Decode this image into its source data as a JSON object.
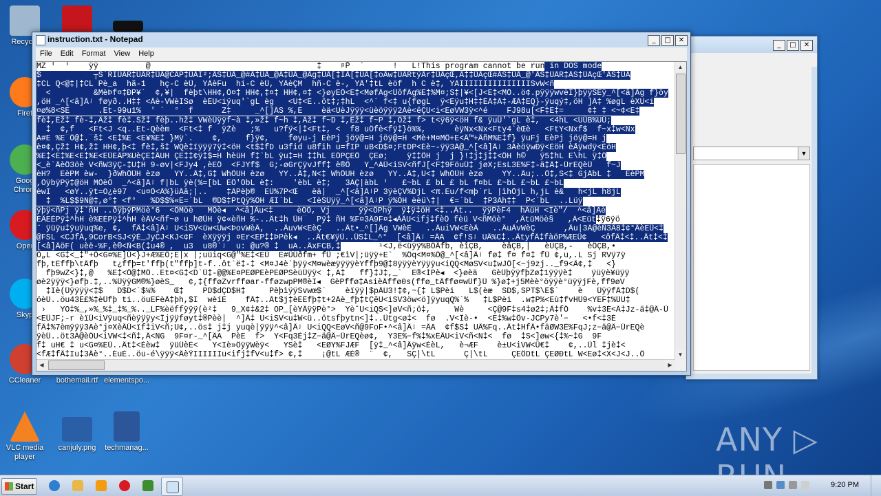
{
  "desktop": {
    "icons": [
      {
        "label": "Recycle",
        "color": "#9fb7cf"
      },
      {
        "label": "",
        "color": "#c4161c"
      },
      {
        "label": "",
        "color": "#111111"
      },
      {
        "label": "Firef",
        "color": "#ff7a1a"
      },
      {
        "label": "Goog\nChrom",
        "color": "#4caf50"
      },
      {
        "label": "Oper",
        "color": "#d81b21"
      },
      {
        "label": "Skyp",
        "color": "#00aff0"
      },
      {
        "label": "CCleaner",
        "color": "#d04030"
      },
      {
        "label": "bothemail.rtf",
        "color": "#ffffff"
      },
      {
        "label": "elementspo...",
        "color": "#eaeaea"
      },
      {
        "label": "VLC media player",
        "color": "#f58220"
      },
      {
        "label": "canjuly.png",
        "color": "#2a5fa8"
      },
      {
        "label": "techmanag...",
        "color": "#2b579a"
      }
    ]
  },
  "back_window": {
    "controls": [
      "_",
      "□",
      "✕"
    ]
  },
  "notepad": {
    "title": "instruction.txt - Notepad",
    "menu": [
      "File",
      "Edit",
      "Format",
      "View",
      "Help"
    ],
    "controls": [
      "_",
      "□",
      "✕"
    ],
    "lines": [
      {
        "text": "MZ ╵  ╵    ÿÿ          @                                   ‡    ᵖP̄  ´      !   L!This program cannot be run in DOS mode",
        "sel_from": 108
      },
      {
        "text": "$           ┬S`RIÜÄR‡ÜÄR‡ÜÄ@CÄP‡ÜÄI²;ÄS‡ÜÄ_@#Ä‡ÜÄ_@Ä‡ÜÄ_@Äg‡ÜÄ[‡IÄ[‡ÜÄ[‡oÄw‡ÜÄRtÿÄr‡ÜÄçŒ‚Ä‡‡ÜÄçŒ#ÄS‡ÜÄ_@'ÄS‡ÜÄR‡ÄS‡ÜÄçŒ'ÄS‡ÜÄ",
        "sel_from": 0
      },
      {
        "text": "‡CL Q<@‡|‡CL Pè_a  hã-1   hç-C èÜ, YÄèFu  hi-C èÜ, YÄèÇM  hñ-C è-, YÄ'‡tL èöf  h C è‡, YÄIIIIIIIIIIIIIIISvW<ñ",
        "sel_from": 0
      },
      {
        "text": "  <         &MèÞf¤‡ÐP¥´  ¢,¥|  fèþt\\HH¢,Ö¤‡ HH¢,‡¤‡ HH¢,¤‡ <}øyEÖ<E‡<MøfÂg<ÜôfÂg%E‡%M¤;S‡|¥<[J<E‡<MÖ..ö¢.pÿÿÿwvèI}þÿÿSEÿ_^[<â]Âg f}öy",
        "sel_from": 0
      },
      {
        "text": ",öH _^[<â]Âʲ føyð..H‡‡ <Äè-VWèISø  èÉU<iÿuq'`gL èg   <U‡<È..ôt‡;‡hL  <^´ f<‡ u{føgL  ÿ<Eÿu‡H‡‡ÉÄ‡Ä‡-ÆÄ‡EQ}-ÿuqý‡,öH ]Â‡ %øgL èXU<i",
        "sel_from": 0
      },
      {
        "text": "¤ø%8<SÈ      .Et-99u1%  ' ´  °  f      Z‡     _^[]ÄS %,È    èä<UèJÿÿÿ<üèöÿÿÿ2Àè<êÇU<i<EøVW3ÿ<^é    FJ98u[<F‡E‡=     ¢‡ ‡ <~¢<E‡",
        "sel_from": 0
      },
      {
        "text": "fè‡,Ëž‡ fè-‡,Äž‡ fè‡.Šž‡ fèþ..hž‡ VWèÜÿÿf~à ‡,»ž‡ f~h ‡,Äž‡ f~D ‡,Ëž‡ f~P ‡,Öž‡ f> t<ÿ6ÿ<öH f& ÿuÜ'`gL è‡,  <4hL <UÜB%UÜ;",
        "sel_from": 0
      },
      {
        "text": "  ‡  ¢,f   <Ft<J <q..Et-Qèèm  <Ft<‡ f  ÿŽè   ;%   u?fÿ<|‡<Ft‡, <  f8 uÖfè<fÿ‡}ö%%,      èÿNx<Nx<Fty4`èŒè   <FtY<Nxf$  f~x‡w<Nx",
        "sel_from": 0
      },
      {
        "text": "A#E %E¯Ö@‡.¯š‡ <E‡%E <E¥%E‡ }Mÿ`.    ¢,     f}ÿ¢,    føyu-j EèPj jöÿ@=H jöÿ@=H <Mè+M¤MÖ+E<Ä™+ÃñM%E‡f} ÿuFj EèPj jöÿ@=H j",
        "sel_from": 0
      },
      {
        "text": "è¤¢,Çž‡ H¢,ž‡ HH¢,þ<‡ fè‡,š‡ WQè‡ïÿÿÿ7ÿ‡<öH <t$‡fD u3fid u8fih u=fIP uB<D$¤;FtDP<Èè~-ÿÿ3À@_^[<â]Âʲ 3ÀèöÿwÐÿ<ÈöH èÅÿwdÿ<ÈöH",
        "sel_from": 0
      },
      {
        "text": "%E‡<E‡%E<E‡%E<EÜEÄP%UèÇE‡ÄUH ÇE‡‡¢ÿ‡$=H hèüH f‡`bL ÿu‡=H ‡‡hL EÖPÇEÖ  ÇEø;    ÿ‡‡ÖH j  j }!‡j‡j‡‡<ÖH h©   ÿ5‡hL E\\hL ÿ‡Ö",
        "sel_from": 0
      },
      {
        "text": "<_è`ÄèÖ3öè V<ñW3ÿÇ-‡U‡H 9-øv|<FJy4 ,èEÖ  <FJYf$  G;-øGrÇÿvJff‡ è®Ö   Y_^ÀÜ<iSV<ñfJ[<F‡9FöuÜ‡ jøX;EsL3E%F‡-ä‡Ä‡-ÜrEQèÜ   f~J",
        "sel_from": 0
      },
      {
        "text": "èH?  EèPM èw-  }ðWhÖÜH èzø   YY..Ä‡,G‡ WhÖUH èzø   YY..Ä‡,N<‡ WhÖUH èzø   YY..Ä‡,U<‡ WhÖÜH èzø    YY..Äu;..Ö‡,S<‡ GjÁbL ‡   EèPM",
        "sel_from": 0
      },
      {
        "text": ",ÖÿbÿPÿ‡@öH MÖèÖ  _^<â]Âʲ f|bL ÿè(%=[bL ÈÖ'ÖbL è‡:    'èbL è‡;   3ÀÇ|àbL ╵   £~bL £ bL £ bL f¤bL £~bL £~bL £~bL",
        "sel_from": 0
      },
      {
        "text": "èwI   <øY..ÿt=O¿è97  <u¤Ö<Â%}üÄâ;|..    ‡ÂPèþ®  EÜ%7P<Œ   èä|  _^[<â]ÂʲP 3ÿèÇV%DjL <π.Éu/f<mþ`rL |ìhÖjL h,jL è&   h<jL h8jL",
        "sel_from": 0
      },
      {
        "text": "  ‡  %L$$9N@‡,ø°‡ <f°   %D$$%«E=`bL  ®D$‡PtQÿ%ÖH ÆI`bL   <ÌèSÜÿÿ_^[<â]ÂʲP ÿ%ÖH èèü\\‡|  €=`bL  ‡P3Äh‡‡  P<`bL  ..Lüÿ",
        "sel_from": 0
      },
      {
        "text": "ÿþÿ<ñPj ÿ‡`ñH ..ðÿþÿPMöè°6  <ÖMöè   MÖè◂  ^<â]Äu<‡     èÓÖ, Vj      ÿÿ<ÖPhÿ  ÿ‡ÿ‡öH <‡..Ät..  ÿÿPèF4  hÄüH <Iè\"/  ^<â]Äè",
        "sel_from": 0
      },
      {
        "text": "ÈÄEÈPÿ‡^hH è%EÈPÿ‡^hH èÄV<ñf~ø u hØÜH ÿ¢«èñH %-..Ät‡h ÜH¯  Pÿ‡ ñH %F¤3Ä9F¤‡◂ÄÄU<ifj‡fèÖ fèü V<ñMöè°  ,ÄtüMöè§   ,À<Eüt‡ÿ6ÿö",
        "sel_from": 0,
        "sel_to": 118
      },
      {
        "text": "¨ ÿüÿu‡ÿuÿuq%e, ¢,  fÄ‡<â]Âʲ U<iSV<üw<Uw<ÞovWèÄ,  ..ÄuvW<EèÇ   ..Ät•_^[]Âg VWèÈ   ..ÄuiVW<ÈèÄ   ..ÄuÄvWèÇ      ,Äu|3Ä@èÑ3Ä8‡¢°ÄèEÜ<‡",
        "sel_from": 0
      },
      {
        "text": "@FSL <CJfÀ,9CorB<SJ<ÿÈ_JyCJ<KJ<¢F  èXÿÿÿj ¤Er<EP‡‡ÞPèk◂  ..Ät€¥ÿÜ..ÜS‡L_^°  [<â]Âʲ =ÄA  ¢f!Sʲ UÄ%C‡..ÄtyfÄ‡fàöP%ÆEÜ¢   <ôfÄ‡<‡..Ät‡<‡",
        "sel_from": 0
      },
      {
        "text": "[<â]ÄöF( uèë-%F,è®<Ñ<B(‡u4® ,  u3  u8®`ʲ  u: @u?® ‡  uA..ÄxFCB,‡        ¹<J,ë<üÿÿ%BÖÄfb, èîÇB,    èâÇB,|   èÛÇB,-   èÖÇB,•",
        "sel_from": 0,
        "sel_to": 64
      },
      {
        "text": "Ö„L <G‡<_‡\"+Ö<G¤%E]Ü<}J+Æ%EÖ;E|x |;uüiq<G@\"%E‡<EÜ  E#ÜÜðfm+ fÜ ;€ìV|;üÿÿ+E`  %Öq<M¤%Ö@_^[<â]Âʲ fø‡ f¤ f¤‡ fÜ ¢,u,.L Sj RVÿ7ÿ",
        "sel_from": -1
      },
      {
        "text": "fþ,tÈffþ\\tÄfþ   t¿ffþ=t'ffþ(t\"ffþ]t-f..ôt`ë‡-‡ <M¤J4è`þÿÿ<M¤wèæÿÿÿÿèYffþ9@‡8ÿÿÿèYÿÿÿu<iQQ<MøSV<u‡wJÖ[<~j9zj.._f9<Ä¢,‡   <}",
        "sel_from": -1
      },
      {
        "text": "  fþ9wZ<}‡,@   %E‡<Ö@‡MÖ..Et¤<G‡<D`Ü‡-@@%E¤PEØPEèPEØPSèüÜÿÿ< ‡,A‡   ff}‡J‡,_`  E®<ÍPè◂  <}øèä   GèÜþÿÿfþZø‡1ÿÿÿè‡    ÿüÿè¥üÿÿ",
        "sel_from": -1
      },
      {
        "text": "øè2ÿÿÿ<}øfþ.‡,..%ÜÿÿGM®%}øèS_   ¢,‡{fføZvrfføar-fføzwpPM®èI◂  GèPffø‡AsièÄffø0s(ffø_tÄffø¤wÜf}Ü %}ø‡+j5Mèè°öÿÿè°üÿÿjFè,ff9øV",
        "sel_from": -1
      },
      {
        "text": "  ‡Iè(Üÿÿÿÿ<‡$   D$D<`$¼%    Œ‡    PD$dÇD$H‡     PèþìÿÿSvwœ$`    èïÿÿ|$pÄU3!‡¢,~{‡ L$Pèi   L$(èæ  SD$,SPT$\\È$`    è   ÜÿÿfÄ‡D$(",
        "sel_from": -1
      },
      {
        "text": "öèÜ..öu43Ë£%‡èÜfþ ti..öuEFèÄ‡þh,$I  wèíÈ    fÄ‡..Ät$j‡èÈÈfþ‡t+2Äè_fþ‡tÇêU<iSV3öw<ö]ÿyuqQ%`%   ‡L$Pèi  .w‡P%<Eù‡fvHÜ9<YEF‡%ÜU‡",
        "sel_from": -1
      },
      {
        "text": " ›   YO‡%_,»%_%‡_‡%_%.._LF%èëffÿÿÿ(è²‡   9_X¢‡&2‡ OP_[èYÄÿÿPè°>  YèˆU<iQS<]øV<ñ;ö‡,     Wè     <Ç@9F‡s4‡ø2‡;Ä‡fÖ    %v‡3É<Ä‡Jz-ä‡@Ä-Ü",
        "sel_from": -1
      },
      {
        "text": "<EÜJF;-r¯èïÜ<iVÿuq<ñèÿÿÿy<Ïjÿÿføyt‡®Pèè|  ^]Ä‡ U<iSV<u‡W<ü..ötsfþytn<]‡..Ütg<ø‡<  fø  .V<Ïè-•  <E‡%w‡Öv-JCPy7è'−   <•f<‡3È",
        "sel_from": -1
      },
      {
        "text": "fÂ‡%7èmÿÿÿ3Aè°j¤XèÄÜ<ïf‡iV<ñ;U¢,..ös‡ j‡j yuqè|ÿÿÿ^<â]Âʲ U<iQQ<EøV<ñ@9FoF•^<â]Âʲ =ÄA  ¢f$S‡ UÄ%Fq..Ät‡HfÄ•fäØW3É%FqJ;z−ä@Ä−ÜrEQè",
        "sel_from": -1
      },
      {
        "text": "ÿèÜ..öt3À@èÖU<iVW<‡<ñ‡,Ä<NG  9F¤r-_^[ÂA  PèE  f>  Y<Fq3Èj‡Z−ä@Ä−ÜrEQèø¢,  Y3E%−f%‡%xÉÄU<iV<ñ<N‡<  fø  ‡S<]øw<{‡%~‡G  9F",
        "sel_from": -1
      },
      {
        "text": "f‡ uH€ ‡ u<G¤%EÜ..Ät‡<Èèw‡  ÿüÜèÈ<   Y<Iè»ÖÿÿWèÿ<   YSè‡   <EØY%FJÆF  [ÿ‡_^<â]Äÿw<ÈèL,   è¬ÆF    è±U<iVW<Ü€‡    ¢,..Ül ‡jè‡<",
        "sel_from": -1
      },
      {
        "text": "<fÆ‡fÄ‡Iu‡3Äè°..ÉuÈ..öu-é\\ÿÿÿ<ÄèŸIIIIIIu<ifj‡fV<u‡f> ¢,‡    ¡@tL ÆÈ®  ¨  ¢,   SÇ|\\tL      Ç|\\tL     ÇEÖDtL ÇEØÐtL W<Eø‡<X<J<J..Ö",
        "sel_from": -1
      }
    ]
  },
  "watermark": {
    "text": "ANY ▷ RUN"
  },
  "taskbar": {
    "start_label": "Start",
    "items": [
      {
        "name": "ie",
        "color": "#2f7fd0"
      },
      {
        "name": "explorer",
        "color": "#e8b84a"
      },
      {
        "name": "media",
        "color": "#f39c12"
      },
      {
        "name": "opera",
        "color": "#d81b21"
      },
      {
        "name": "grid",
        "color": "#3c8d2f"
      },
      {
        "name": "notepad",
        "color": "#cfe3f6"
      }
    ],
    "clock": "9:20 PM"
  }
}
